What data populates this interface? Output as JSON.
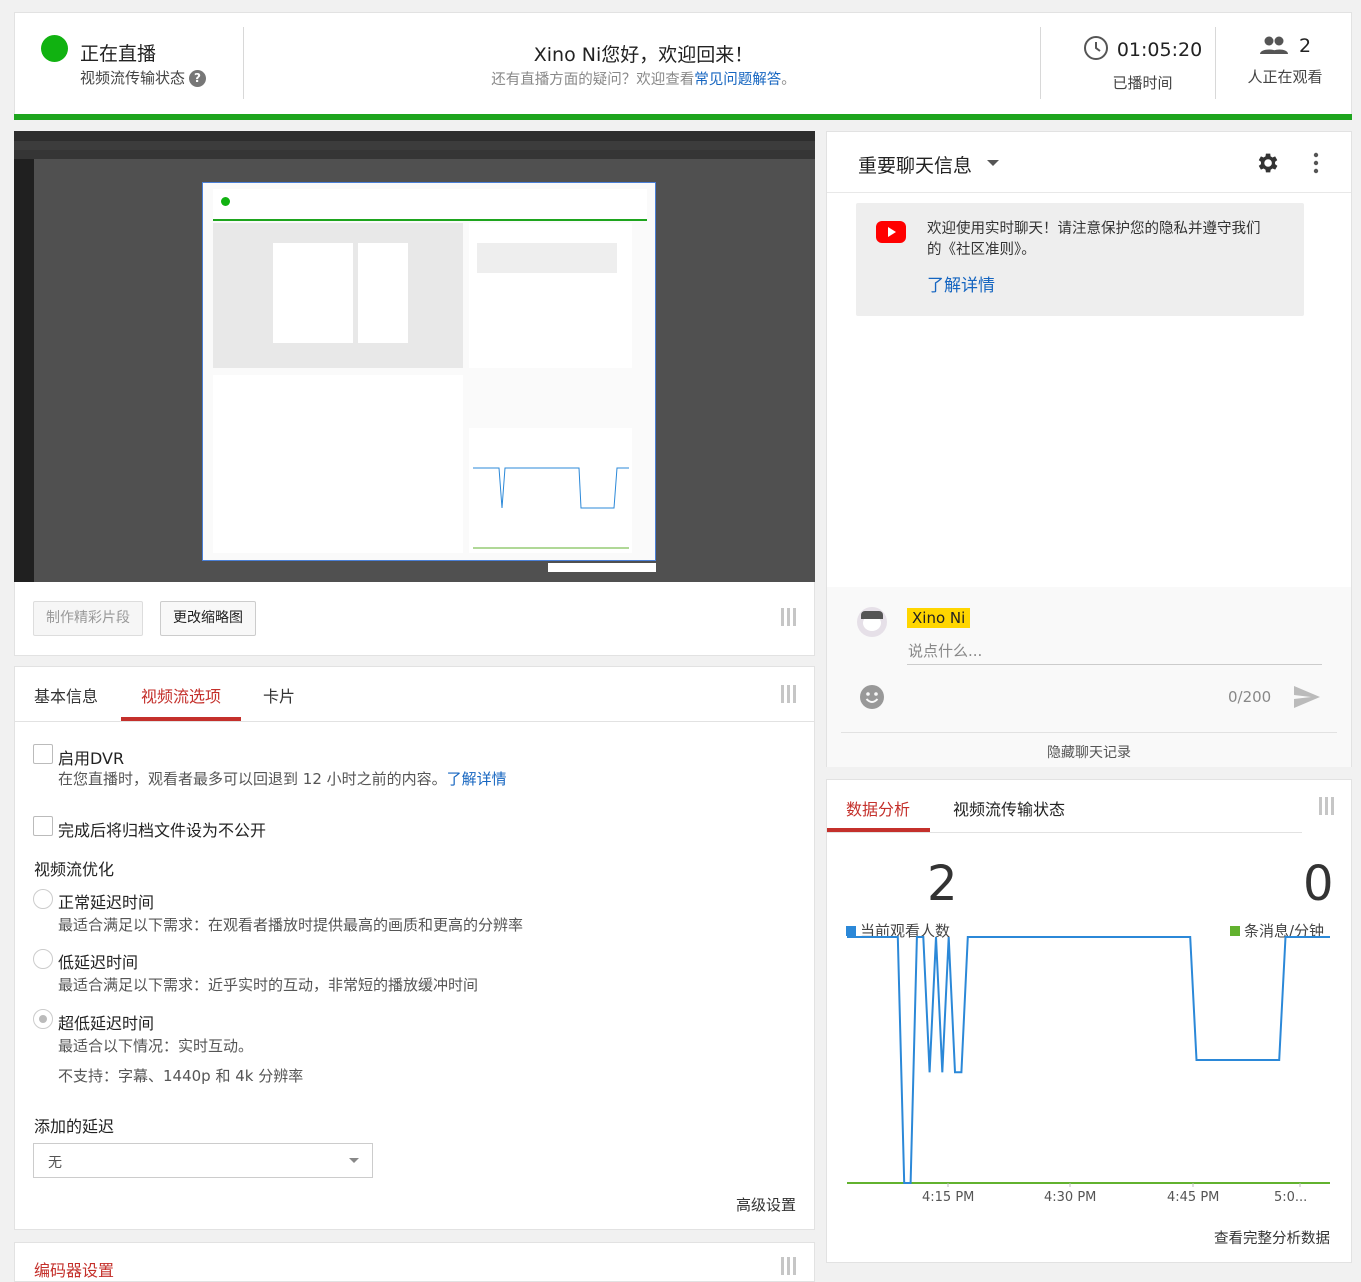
{
  "header": {
    "live_title": "正在直播",
    "stream_status_label": "视频流传输状态",
    "welcome_title": "Xino Ni您好，欢迎回来！",
    "welcome_sub_prefix": "还有直播方面的疑问？欢迎查看",
    "welcome_sub_link": "常见问题解答",
    "welcome_sub_suffix": "。",
    "elapsed_time": "01:05:20",
    "elapsed_label": "已播时间",
    "viewers_count": "2",
    "viewers_label": "人正在观看",
    "status_color": "#1ea51e"
  },
  "preview_actions": {
    "clip_button": "制作精彩片段",
    "thumbnail_button": "更改缩略图"
  },
  "settings": {
    "tabs": [
      "基本信息",
      "视频流选项",
      "卡片"
    ],
    "active_tab": "视频流选项",
    "dvr_label": "启用DVR",
    "dvr_desc": "在您直播时，观看者最多可以回退到 12 小时之前的内容。",
    "dvr_link": "了解详情",
    "archive_private_label": "完成后将归档文件设为不公开",
    "optimization_title": "视频流优化",
    "latency_options": [
      {
        "label": "正常延迟时间",
        "desc": "最适合满足以下需求：在观看者播放时提供最高的画质和更高的分辨率",
        "checked": false
      },
      {
        "label": "低延迟时间",
        "desc": "最适合满足以下需求：近乎实时的互动，非常短的播放缓冲时间",
        "checked": false
      },
      {
        "label": "超低延迟时间",
        "desc": "最适合以下情况：实时互动。",
        "desc2": "不支持：字幕、1440p 和 4k 分辨率",
        "checked": true
      }
    ],
    "added_delay_title": "添加的延迟",
    "added_delay_value": "无",
    "advanced_link": "高级设置",
    "encoder_section_title": "编码器设置"
  },
  "chat": {
    "title": "重要聊天信息",
    "notice_text_line1": "欢迎使用实时聊天！请注意保护您的隐私并遵守我们",
    "notice_text_line2": "的《社区准则》。",
    "notice_link": "了解详情",
    "username": "Xino Ni",
    "input_placeholder": "说点什么...",
    "char_count": "0/200",
    "hide_chat": "隐藏聊天记录"
  },
  "analytics": {
    "tabs": [
      "数据分析",
      "视频流传输状态"
    ],
    "active_tab": "数据分析",
    "viewers_value": "2",
    "viewers_label": "当前观看人数",
    "messages_value": "0",
    "messages_label": "条消息/分钟",
    "viewers_color": "#2b88d8",
    "messages_color": "#62b22f",
    "full_report_link": "查看完整分析数据",
    "chart_data": {
      "type": "line",
      "x_tick_labels": [
        "4:15 PM",
        "4:30 PM",
        "4:45 PM",
        "5:0..."
      ],
      "series": [
        {
          "name": "当前观看人数",
          "points": [
            [
              0,
              2
            ],
            [
              0.4,
              2
            ],
            [
              0.45,
              0
            ],
            [
              0.5,
              0
            ],
            [
              0.55,
              2
            ],
            [
              0.6,
              2
            ],
            [
              0.65,
              0.9
            ],
            [
              0.7,
              2
            ],
            [
              0.75,
              0.9
            ],
            [
              0.8,
              2
            ],
            [
              0.85,
              0.9
            ],
            [
              0.9,
              0.9
            ],
            [
              0.95,
              2
            ],
            [
              1.0,
              2
            ],
            [
              2.0,
              2
            ],
            [
              2.7,
              2
            ],
            [
              2.75,
              1
            ],
            [
              3.4,
              1
            ],
            [
              3.45,
              2
            ],
            [
              3.8,
              2
            ]
          ]
        },
        {
          "name": "条消息/分钟",
          "points": [
            [
              0,
              0
            ],
            [
              3.8,
              0
            ]
          ]
        }
      ]
    }
  }
}
